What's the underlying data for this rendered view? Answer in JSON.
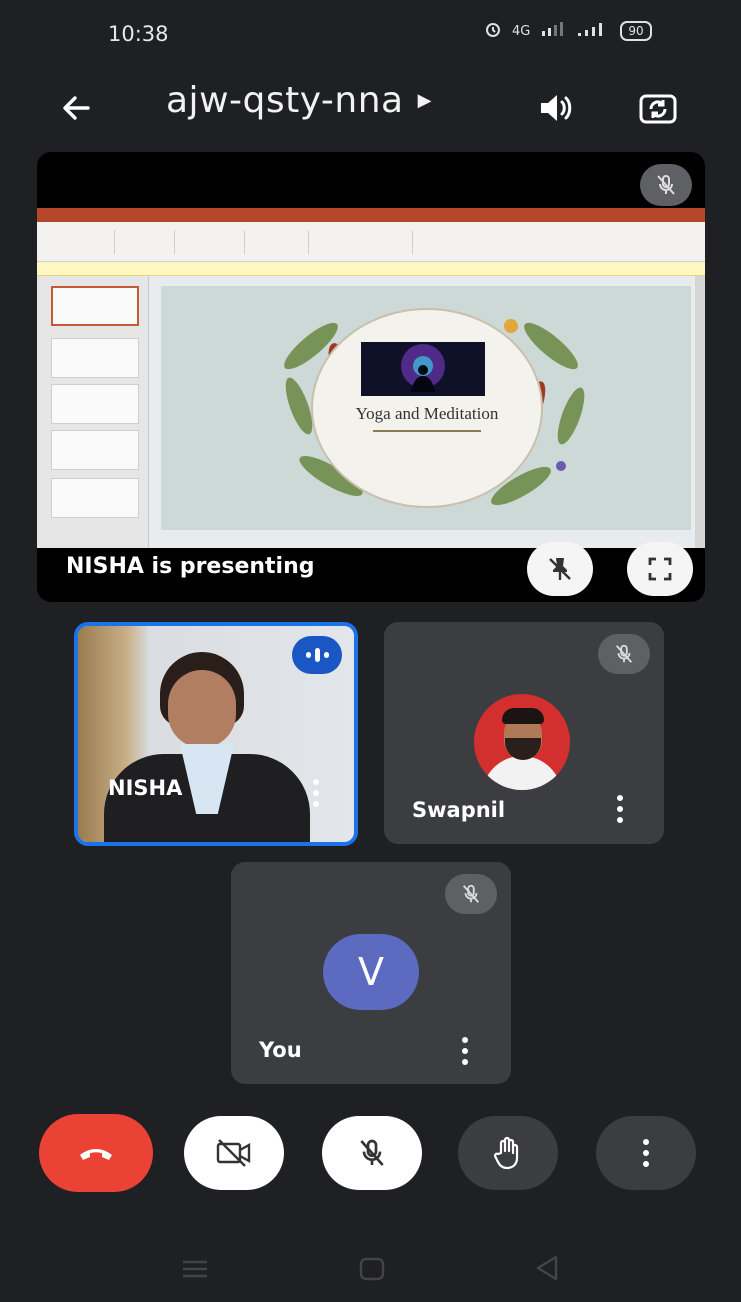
{
  "status_bar": {
    "time": "10:38",
    "icons": [
      "alarm-icon",
      "data-4g-icon",
      "volte-signal-icon",
      "signal-icon"
    ],
    "battery": "90"
  },
  "header": {
    "title": "ajw-qsty-nna",
    "icons": [
      "back-arrow-icon",
      "caret-right-icon",
      "speaker-icon",
      "switch-camera-icon"
    ]
  },
  "presentation": {
    "label": "NISHA is presenting",
    "slide_title": "Yoga and Meditation",
    "icons": [
      "mic-off-icon",
      "unpin-icon",
      "fullscreen-icon"
    ]
  },
  "participants": [
    {
      "name": "NISHA",
      "speaking": true
    },
    {
      "name": "Swapnil",
      "muted": true
    },
    {
      "name": "You",
      "avatar_letter": "V",
      "muted": true
    }
  ],
  "controls": {
    "icons": [
      "end-call-icon",
      "camera-off-icon",
      "mic-off-icon",
      "raise-hand-icon",
      "more-options-icon"
    ],
    "colors": {
      "end": "#ea4335",
      "light": "#ffffff",
      "dark": "#3c3d40",
      "speaking": "#1a57c4",
      "you_avatar": "#5c6bc0"
    }
  },
  "nav_bar": {
    "icons": [
      "recents-icon",
      "home-icon",
      "back-icon"
    ]
  }
}
